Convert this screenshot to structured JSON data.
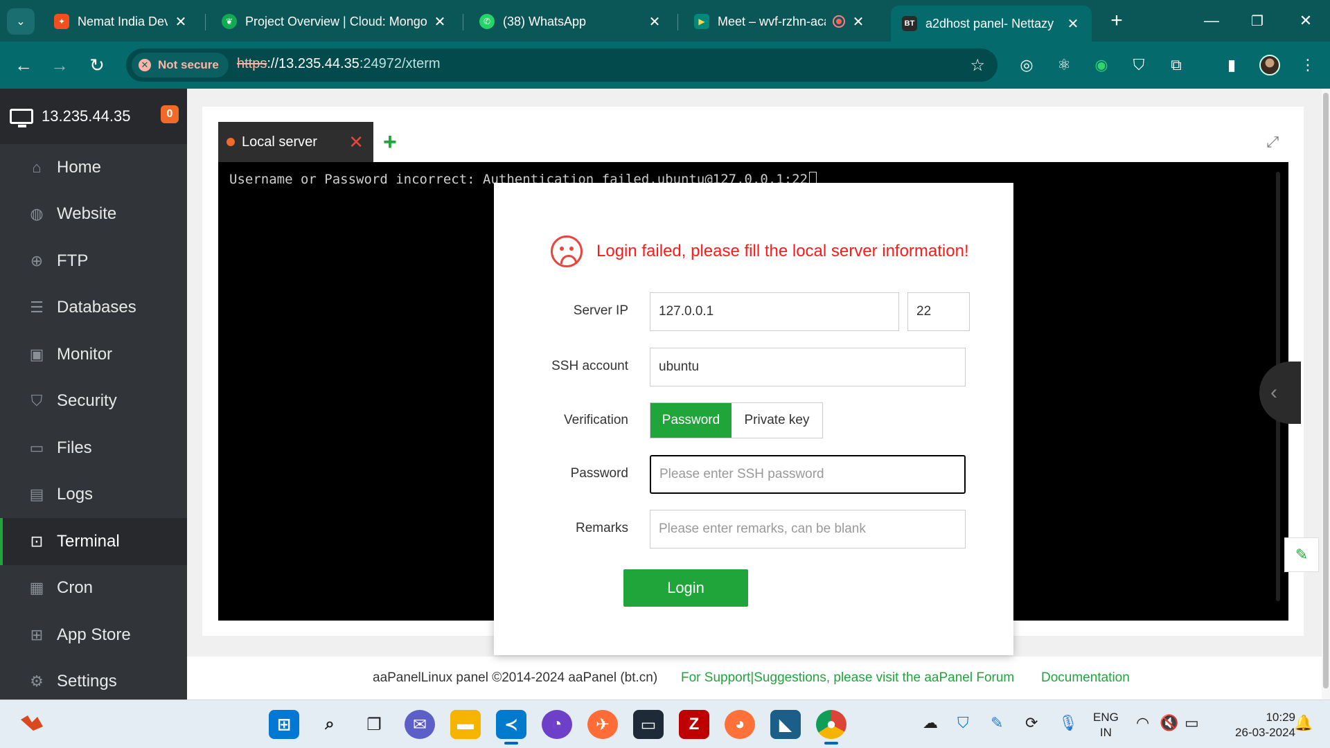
{
  "browser": {
    "tabs": [
      {
        "label": "Nemat India Dev File – Figma",
        "icon": "figma-icon",
        "favicon_color": "#f24e1e"
      },
      {
        "label": "Project Overview | Cloud: MongoDB",
        "icon": "mongodb-leaf-icon",
        "favicon_color": "#13aa52"
      },
      {
        "label": "(38) WhatsApp",
        "icon": "whatsapp-icon",
        "favicon_color": "#25d366"
      },
      {
        "label": "Meet – wvf-rzhn-aca",
        "icon": "google-meet-icon",
        "favicon_color": "#00897b"
      },
      {
        "label": "a2dhost panel- Nettazy",
        "icon": "bt-icon",
        "favicon_text": "BT"
      }
    ],
    "new_tab": "+",
    "address": {
      "security_chip": "Not secure",
      "url_scheme": "https",
      "url_sep": "://",
      "url_host": "13.235.44.35",
      "url_rest": ":24972/xterm"
    }
  },
  "sidebar": {
    "host": "13.235.44.35",
    "badge": "0",
    "items": [
      {
        "label": "Home",
        "icon": "home-icon"
      },
      {
        "label": "Website",
        "icon": "globe-icon"
      },
      {
        "label": "FTP",
        "icon": "ftp-icon"
      },
      {
        "label": "Databases",
        "icon": "database-icon"
      },
      {
        "label": "Monitor",
        "icon": "monitor-chart-icon"
      },
      {
        "label": "Security",
        "icon": "shield-icon"
      },
      {
        "label": "Files",
        "icon": "folder-icon"
      },
      {
        "label": "Logs",
        "icon": "logs-icon"
      },
      {
        "label": "Terminal",
        "icon": "terminal-icon",
        "active": true
      },
      {
        "label": "Cron",
        "icon": "calendar-icon"
      },
      {
        "label": "App Store",
        "icon": "grid-icon"
      },
      {
        "label": "Settings",
        "icon": "gear-icon"
      }
    ]
  },
  "terminal": {
    "tab_label": "Local server",
    "add": "+",
    "output_line": "Username or Password incorrect: Authentication failed.ubuntu@127.0.0.1:22"
  },
  "dialog": {
    "message": "Login failed, please fill the local server information!",
    "server_ip_label": "Server IP",
    "server_ip_value": "127.0.0.1",
    "port_value": "22",
    "ssh_account_label": "SSH account",
    "ssh_account_value": "ubuntu",
    "verification_label": "Verification",
    "verification_options": [
      "Password",
      "Private key"
    ],
    "verification_selected": "Password",
    "password_label": "Password",
    "password_placeholder": "Please enter SSH password",
    "remarks_label": "Remarks",
    "remarks_placeholder": "Please enter remarks, can be blank",
    "login_button": "Login"
  },
  "footer": {
    "copyright": "aaPanelLinux panel ©2014-2024 aaPanel (bt.cn)",
    "support_link": "For Support|Suggestions, please visit the aaPanel Forum",
    "docs_link": "Documentation"
  },
  "taskbar": {
    "apps": [
      "windows-start-icon",
      "search-icon",
      "task-view-icon",
      "teams-chat-icon",
      "file-explorer-icon",
      "vscode-icon",
      "github-desktop-icon",
      "postman-icon",
      "terminal-app-icon",
      "filezilla-icon",
      "firefox-icon",
      "mysql-workbench-icon",
      "chrome-icon"
    ],
    "language_top": "ENG",
    "language_bottom": "IN",
    "time": "10:29",
    "date": "26-03-2024"
  },
  "colors": {
    "browser_frame": "#046a6b",
    "accent_green": "#20a53a",
    "error_red": "#ff1a1a",
    "sidebar_bg": "#31353a",
    "badge_orange": "#f06a29"
  }
}
